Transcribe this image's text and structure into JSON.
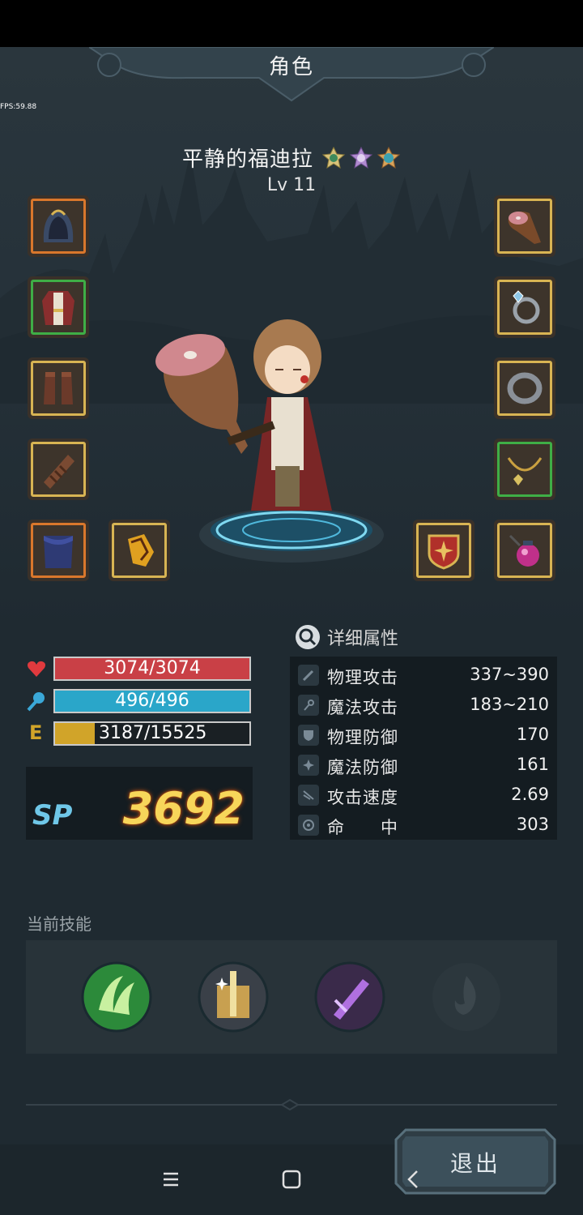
{
  "header": {
    "title": "角色"
  },
  "debug": {
    "fps": "FPS:59.88"
  },
  "character": {
    "name": "平静的福迪拉",
    "level": "Lv 11",
    "badges": [
      "gold-rank-badge-icon",
      "purple-rank-badge-icon",
      "blue-rank-badge-icon"
    ]
  },
  "equipment": {
    "left": [
      {
        "name": "hood-icon",
        "rarity": "orange"
      },
      {
        "name": "robe-armor-icon",
        "rarity": "green"
      },
      {
        "name": "boots-icon",
        "rarity": "gold"
      },
      {
        "name": "bracer-icon",
        "rarity": "gold"
      },
      {
        "name": "pants-icon",
        "rarity": "orange"
      },
      {
        "name": "gold-gauntlet-icon",
        "rarity": "gold"
      }
    ],
    "right": [
      {
        "name": "ham-weapon-icon",
        "rarity": "gold"
      },
      {
        "name": "gem-ring-icon",
        "rarity": "gold"
      },
      {
        "name": "iron-ring-icon",
        "rarity": "gold"
      },
      {
        "name": "necklace-icon",
        "rarity": "green"
      },
      {
        "name": "shield-emblem-icon",
        "rarity": "gold"
      },
      {
        "name": "potion-charm-icon",
        "rarity": "gold"
      }
    ]
  },
  "bars": {
    "hp": {
      "text": "3074/3074",
      "fraction": 1.0,
      "color": "#c94046"
    },
    "mp": {
      "text": "496/496",
      "fraction": 1.0,
      "color": "#2aa6c9"
    },
    "exp": {
      "label": "E",
      "text": "3187/15525",
      "fraction": 0.205,
      "color": "#d1a429"
    }
  },
  "sp": {
    "label": "SP",
    "value": "3692"
  },
  "details": {
    "title": "详细属性",
    "rows": [
      {
        "name": "物理攻击",
        "value": "337~390",
        "icon": "sword-icon"
      },
      {
        "name": "魔法攻击",
        "value": "183~210",
        "icon": "staff-icon"
      },
      {
        "name": "物理防御",
        "value": "170",
        "icon": "shield-icon"
      },
      {
        "name": "魔法防御",
        "value": "161",
        "icon": "magic-shield-icon"
      },
      {
        "name": "攻击速度",
        "value": "2.69",
        "icon": "speed-icon"
      },
      {
        "name": "命　　中",
        "value": "303",
        "icon": "target-icon"
      }
    ]
  },
  "skills": {
    "title": "当前技能",
    "items": [
      {
        "name": "wind-slash-skill-icon",
        "state": "active"
      },
      {
        "name": "holy-sword-skill-icon",
        "state": "active"
      },
      {
        "name": "shadow-blade-skill-icon",
        "state": "active"
      },
      {
        "name": "flame-skill-icon",
        "state": "locked"
      }
    ]
  },
  "exit": {
    "label": "退出"
  },
  "navbar": {
    "items": [
      "menu-icon",
      "home-icon",
      "back-icon"
    ]
  },
  "colors": {
    "accent_gold": "#d8b453",
    "rarity_orange": "#d9772c",
    "rarity_green": "#3fae46",
    "sp_value": "#f7d65a"
  }
}
